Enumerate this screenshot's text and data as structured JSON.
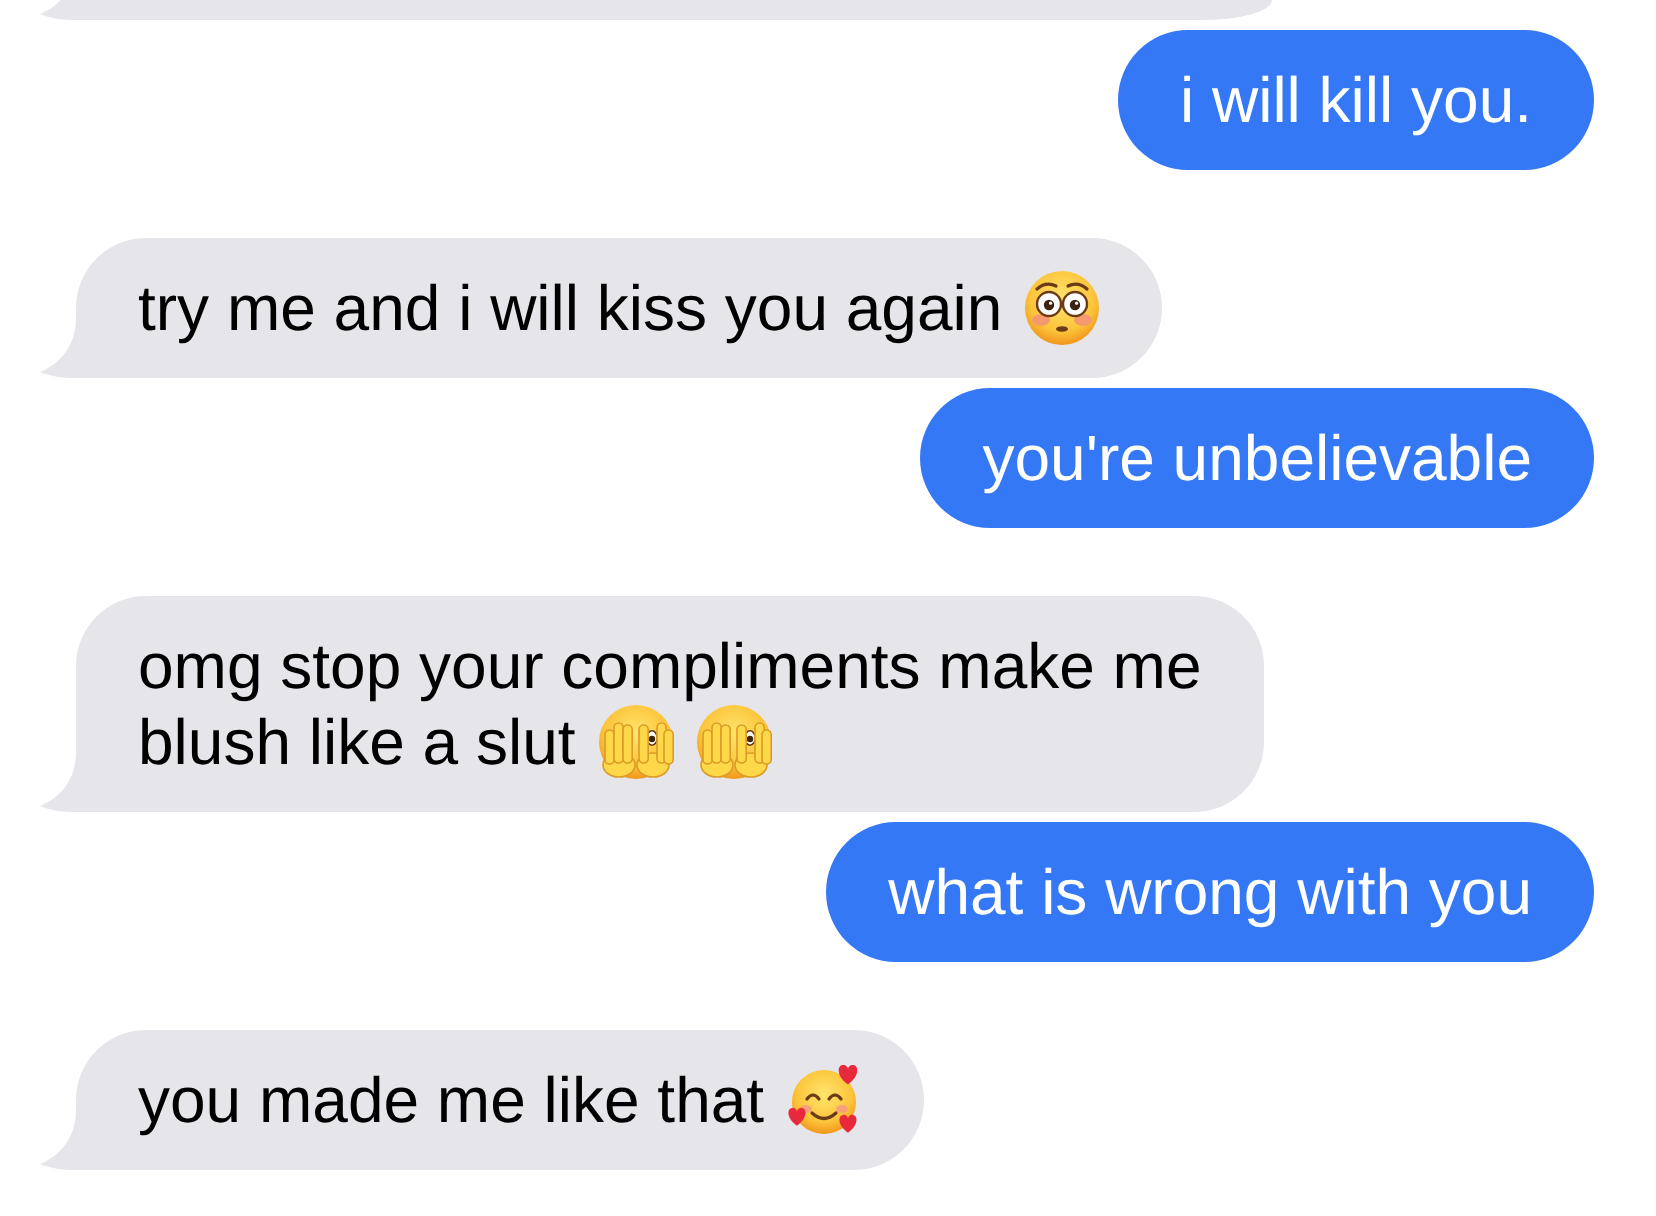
{
  "cut_off_bubble": {
    "outgoing": false
  },
  "messages": [
    {
      "outgoing": true,
      "lines": [
        "i will kill you."
      ]
    },
    {
      "outgoing": false,
      "lines": [
        "try me and i will kiss you again"
      ],
      "emoji": [
        {
          "kind": "flushed"
        }
      ]
    },
    {
      "outgoing": true,
      "lines": [
        "you're unbelievable"
      ]
    },
    {
      "outgoing": false,
      "lines": [
        "omg stop your compliments make me",
        "blush like a slut"
      ],
      "emoji": [
        {
          "kind": "peeking"
        },
        {
          "kind": "peeking"
        }
      ]
    },
    {
      "outgoing": true,
      "lines": [
        "what is wrong with you"
      ]
    },
    {
      "outgoing": false,
      "lines": [
        "you made me like that"
      ],
      "emoji": [
        {
          "kind": "smiling-hearts"
        }
      ]
    }
  ]
}
